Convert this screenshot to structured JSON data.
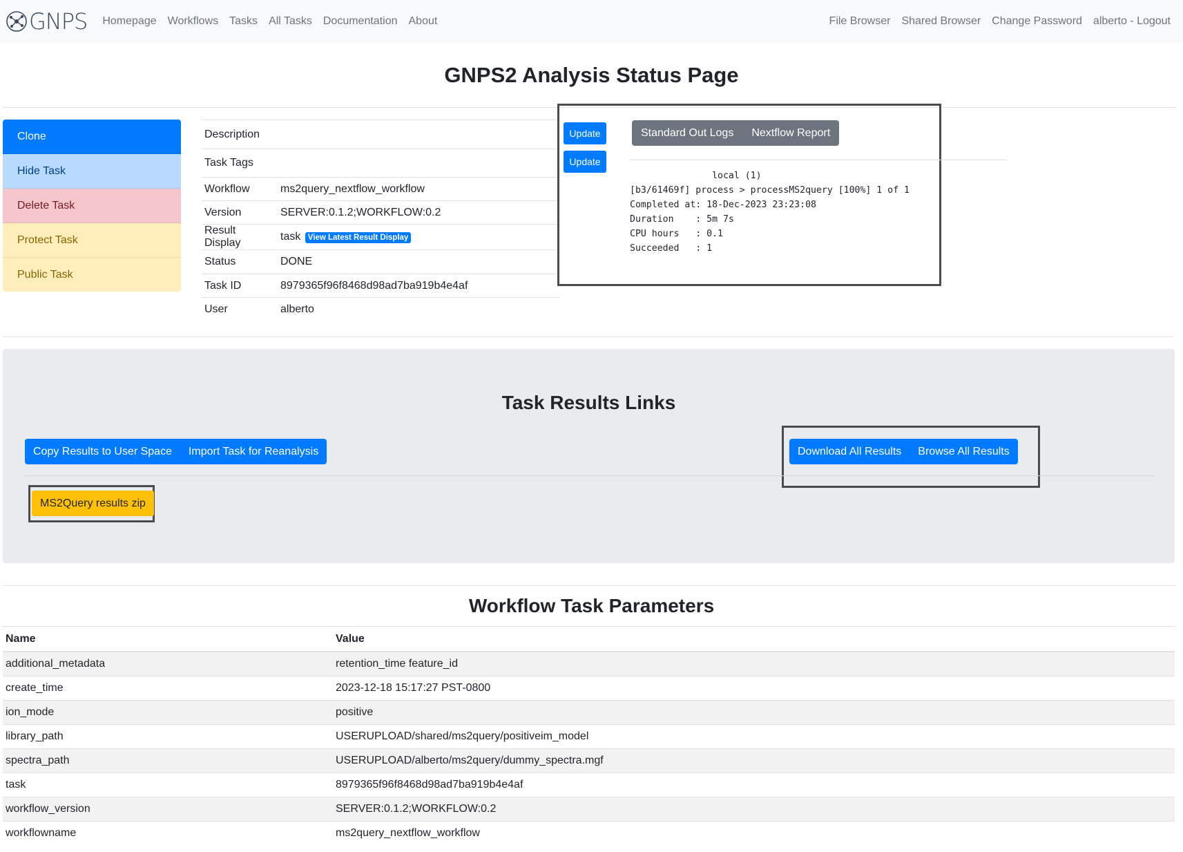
{
  "nav": {
    "brand": "GNPS",
    "left_links": [
      "Homepage",
      "Workflows",
      "Tasks",
      "All Tasks",
      "Documentation",
      "About"
    ],
    "right_links": [
      "File Browser",
      "Shared Browser",
      "Change Password",
      "alberto - Logout"
    ]
  },
  "page_title": "GNPS2 Analysis Status Page",
  "side_menu": {
    "clone": "Clone",
    "hide": "Hide Task",
    "delete": "Delete Task",
    "protect": "Protect Task",
    "public": "Public Task"
  },
  "task_info": {
    "description_label": "Description",
    "description_value": "",
    "tags_label": "Task Tags",
    "tags_value": "",
    "workflow_label": "Workflow",
    "workflow_value": "ms2query_nextflow_workflow",
    "version_label": "Version",
    "version_value": "SERVER:0.1.2;WORKFLOW:0.2",
    "result_display_label": "Result Display",
    "result_display_value": "task",
    "result_display_badge": "View Latest Result Display",
    "status_label": "Status",
    "status_value": "DONE",
    "task_id_label": "Task ID",
    "task_id_value": "8979365f96f8468d98ad7ba919b4e4af",
    "user_label": "User",
    "user_value": "alberto"
  },
  "update_buttons": [
    "Update",
    "Update"
  ],
  "logs": {
    "tabs": [
      "Standard Out Logs",
      "Nextflow Report"
    ],
    "text": "               local (1)\n[b3/61469f] process > processMS2query [100%] 1 of 1\nCompleted at: 18-Dec-2023 23:23:08\nDuration    : 5m 7s\nCPU hours   : 0.1\nSucceeded   : 1"
  },
  "results": {
    "title": "Task Results Links",
    "copy_results": "Copy Results to User Space",
    "import_task": "Import Task for Reanalysis",
    "download_all": "Download All Results",
    "browse_all": "Browse All Results",
    "zip_button": "MS2Query results zip"
  },
  "params": {
    "title": "Workflow Task Parameters",
    "headers": [
      "Name",
      "Value"
    ],
    "rows": [
      [
        "additional_metadata",
        "retention_time feature_id"
      ],
      [
        "create_time",
        "2023-12-18 15:17:27 PST-0800"
      ],
      [
        "ion_mode",
        "positive"
      ],
      [
        "library_path",
        "USERUPLOAD/shared/ms2query/positiveim_model"
      ],
      [
        "spectra_path",
        "USERUPLOAD/alberto/ms2query/dummy_spectra.mgf"
      ],
      [
        "task",
        "8979365f96f8468d98ad7ba919b4e4af"
      ],
      [
        "workflow_version",
        "SERVER:0.1.2;WORKFLOW:0.2"
      ],
      [
        "workflowname",
        "ms2query_nextflow_workflow"
      ]
    ]
  }
}
